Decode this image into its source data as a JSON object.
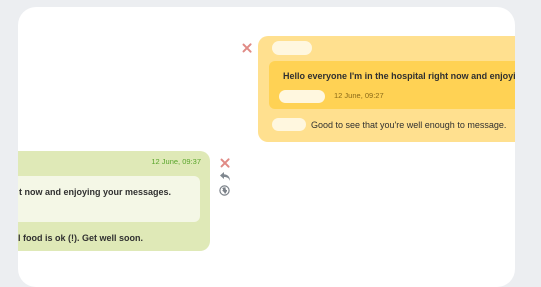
{
  "messages": {
    "outgoing": {
      "quote_text": "Hello everyone I'm in the hospital right now and enjoying your messages.",
      "quote_time": "12 June, 09:27",
      "text": "Good to see that you're well enough to message."
    },
    "incoming": {
      "time": "12 June, 09:37",
      "quote_text": "t now and enjoying your messages.",
      "text": "l food is ok (!). Get well soon."
    }
  },
  "icons": {
    "delete": "close-icon",
    "reply": "reply-icon",
    "translate": "globe-icon"
  },
  "colors": {
    "background": "#eceef1",
    "outgoing_bubble": "#ffe08f",
    "outgoing_quote": "#ffd254",
    "incoming_bubble": "#dfe9b7",
    "incoming_quote": "#f4f7e6",
    "incoming_time": "#59a52b",
    "delete_icon": "#e08a85"
  }
}
